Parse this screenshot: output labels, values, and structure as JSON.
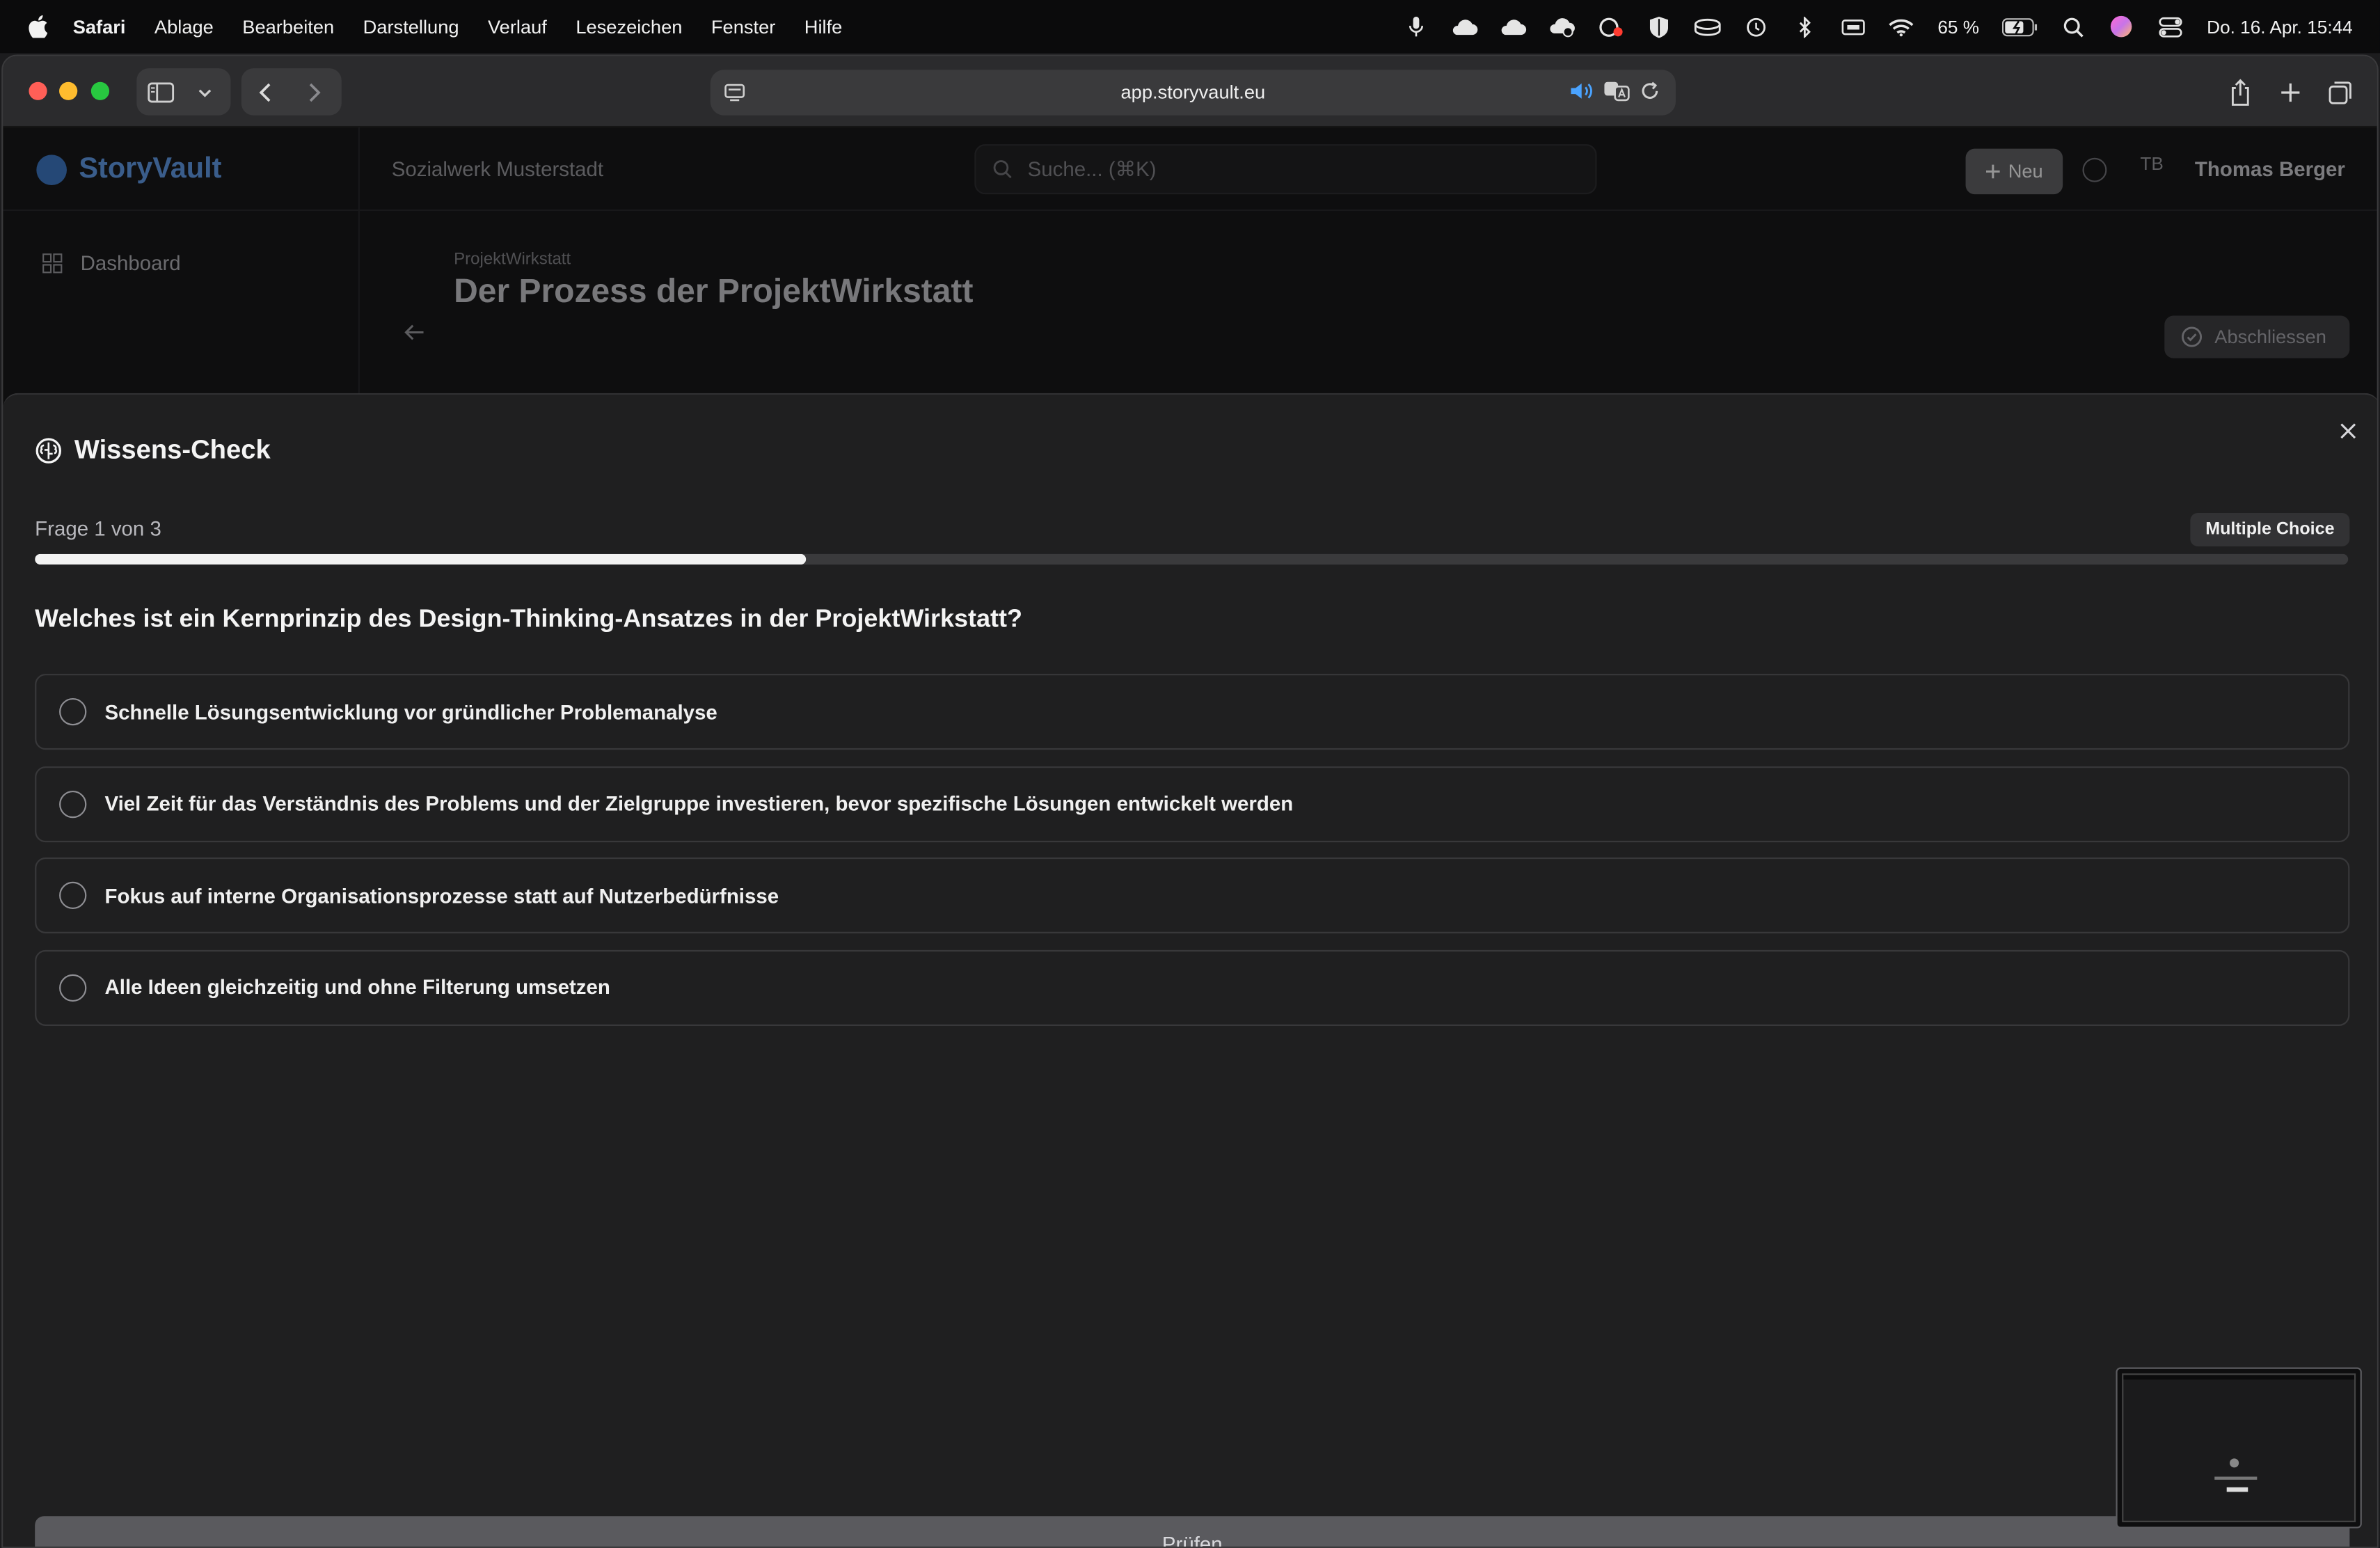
{
  "menubar": {
    "app_name": "Safari",
    "items": [
      "Ablage",
      "Bearbeiten",
      "Darstellung",
      "Verlauf",
      "Lesezeichen",
      "Fenster",
      "Hilfe"
    ],
    "battery": "65 %",
    "datetime": "Do. 16. Apr.  15:44"
  },
  "browser": {
    "url": "app.storyvault.eu"
  },
  "app": {
    "brand": "StoryVault",
    "organization": "Sozialwerk Musterstadt",
    "search_placeholder": "Suche... (⌘K)",
    "new_label": "Neu",
    "avatar_initials": "TB",
    "user_name": "Thomas Berger",
    "nav_dashboard": "Dashboard",
    "breadcrumb": "ProjektWirkstatt",
    "page_title": "Der Prozess der ProjektWirkstatt",
    "finish_label": "Abschliessen"
  },
  "quiz": {
    "title": "Wissens-Check",
    "counter": "Frage 1 von 3",
    "type_badge": "Multiple Choice",
    "progress_fraction": 0.3333,
    "question": "Welches ist ein Kernprinzip des Design-Thinking-Ansatzes in der ProjektWirkstatt?",
    "options": [
      "Schnelle Lösungsentwicklung vor gründlicher Problemanalyse",
      "Viel Zeit für das Verständnis des Problems und der Zielgruppe investieren, bevor spezifische Lösungen entwickelt werden",
      "Fokus auf interne Organisationsprozesse statt auf Nutzerbedürfnisse",
      "Alle Ideen gleichzeitig und ohne Filterung umsetzen"
    ],
    "submit_label": "Prüfen"
  },
  "colors": {
    "traffic_red": "#ff5f57",
    "traffic_yellow": "#febc2e",
    "traffic_green": "#28c840",
    "brand_blue": "#5a8fd6",
    "progress_fill": "#f2f2f2"
  }
}
